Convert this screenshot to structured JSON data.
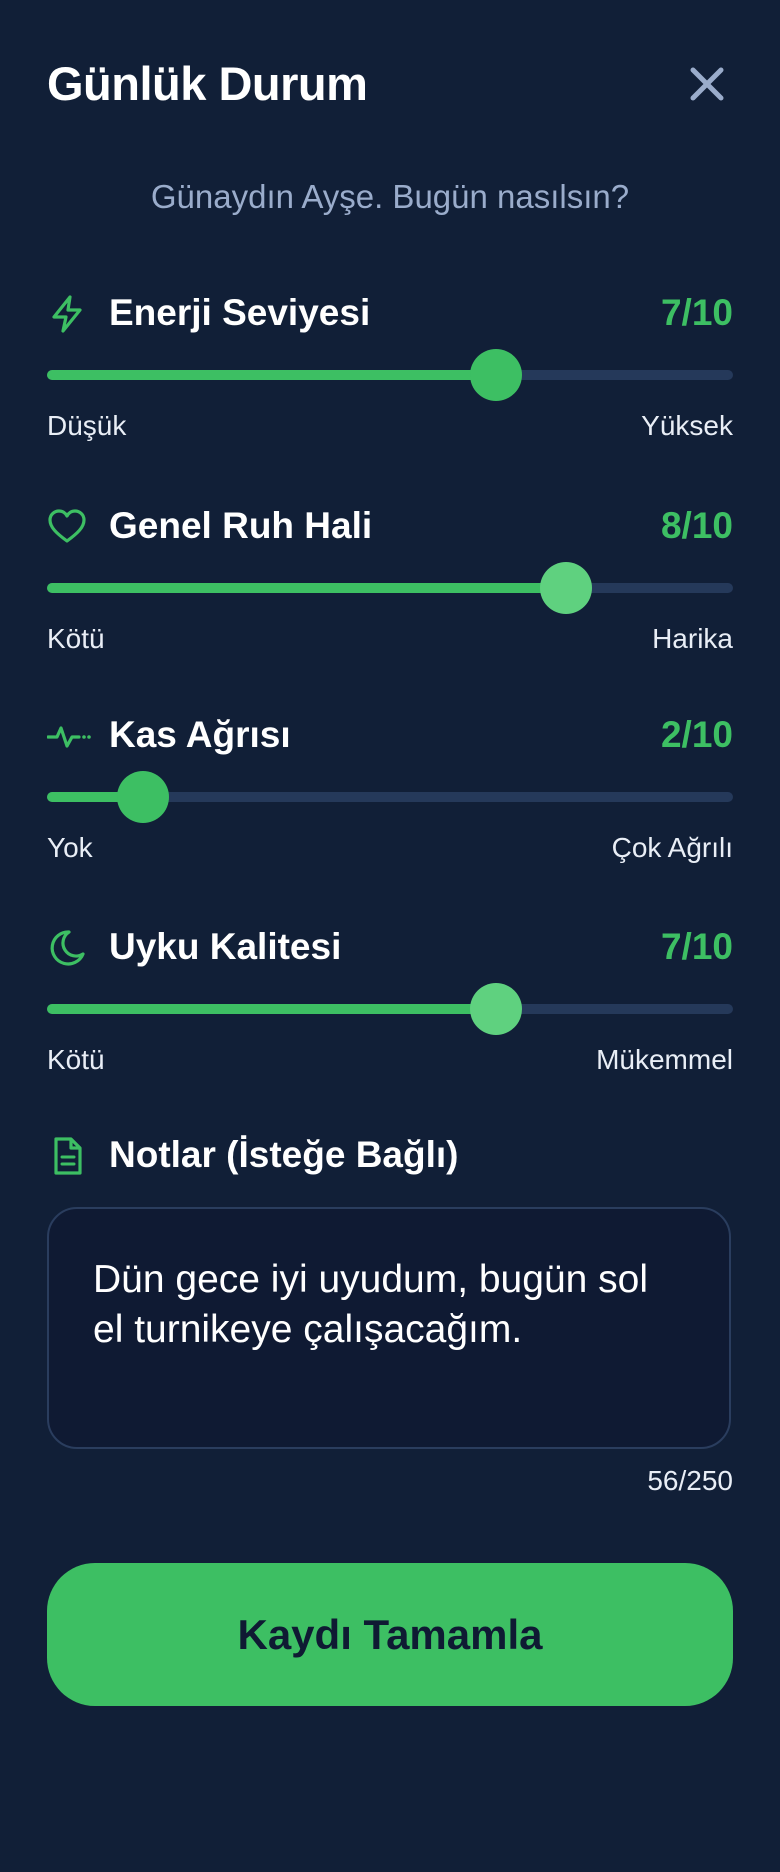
{
  "header": {
    "title": "Günlük Durum",
    "close_icon": "close-icon"
  },
  "greeting": "Günaydın Ayşe. Bugün nasılsın?",
  "colors": {
    "background": "#111f37",
    "accent": "#3dbf63",
    "track": "#25395a",
    "muted_text": "#9aaccb"
  },
  "metrics": [
    {
      "icon": "lightning-icon",
      "label": "Enerji Seviyesi",
      "value_text": "7/10",
      "value": 7,
      "max": 10,
      "low_label": "Düşük",
      "high_label": "Yüksek"
    },
    {
      "icon": "heart-icon",
      "label": "Genel Ruh Hali",
      "value_text": "8/10",
      "value": 8,
      "max": 10,
      "low_label": "Kötü",
      "high_label": "Harika"
    },
    {
      "icon": "pulse-icon",
      "label": "Kas Ağrısı",
      "value_text": "2/10",
      "value": 2,
      "max": 10,
      "low_label": "Yok",
      "high_label": "Çok Ağrılı"
    },
    {
      "icon": "moon-icon",
      "label": "Uyku Kalitesi",
      "value_text": "7/10",
      "value": 7,
      "max": 10,
      "low_label": "Kötü",
      "high_label": "Mükemmel"
    }
  ],
  "notes": {
    "icon": "document-icon",
    "label": "Notlar (İsteğe Bağlı)",
    "value": "Dün gece iyi uyudum, bugün sol el turnikeye çalışacağım.",
    "char_count": "56/250"
  },
  "submit_label": "Kaydı Tamamla"
}
